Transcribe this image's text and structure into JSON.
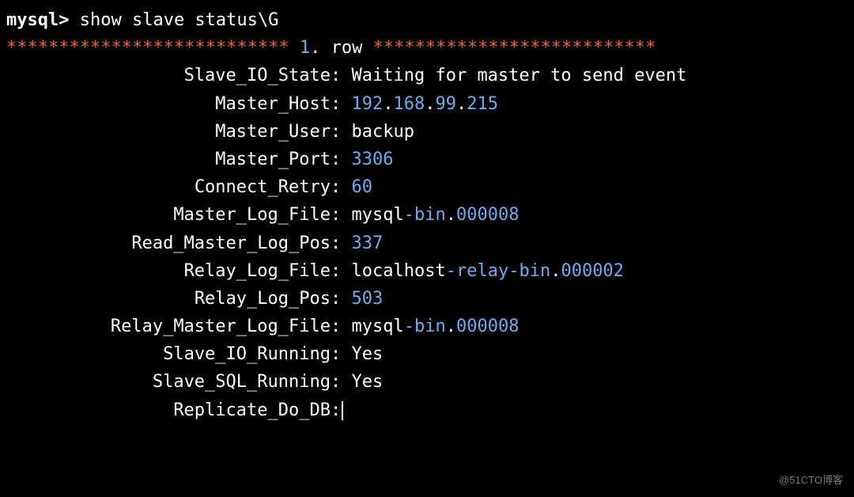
{
  "prompt": "mysql>",
  "command": "show slave status\\G",
  "rowHeader": {
    "starsLeft": "***************************",
    "num": "1",
    "dot": ".",
    "label": "row",
    "starsRight": "***************************"
  },
  "rows": {
    "slave_io_state": {
      "key": "Slave_IO_State",
      "val": "Waiting for master to send event"
    },
    "master_host": {
      "key": "Master_Host",
      "ip": [
        "192",
        "168",
        "99",
        "215"
      ]
    },
    "master_user": {
      "key": "Master_User",
      "val": "backup"
    },
    "master_port": {
      "key": "Master_Port",
      "val": "3306"
    },
    "connect_retry": {
      "key": "Connect_Retry",
      "val": "60"
    },
    "master_log_file": {
      "key": "Master_Log_File",
      "pre": "mysql",
      "mid": "bin",
      "suf": "000008"
    },
    "read_master_log_pos": {
      "key": "Read_Master_Log_Pos",
      "val": "337"
    },
    "relay_log_file": {
      "key": "Relay_Log_File",
      "p1": "localhost",
      "p2": "relay",
      "p3": "bin",
      "suf": "000002"
    },
    "relay_log_pos": {
      "key": "Relay_Log_Pos",
      "val": "503"
    },
    "relay_master_log_file": {
      "key": "Relay_Master_Log_File",
      "pre": "mysql",
      "mid": "bin",
      "suf": "000008"
    },
    "slave_io_running": {
      "key": "Slave_IO_Running",
      "val": "Yes"
    },
    "slave_sql_running": {
      "key": "Slave_SQL_Running",
      "val": "Yes"
    },
    "replicate_do_db": {
      "key": "Replicate_Do_DB",
      "val": ""
    }
  },
  "watermark": "@51CTO博客"
}
